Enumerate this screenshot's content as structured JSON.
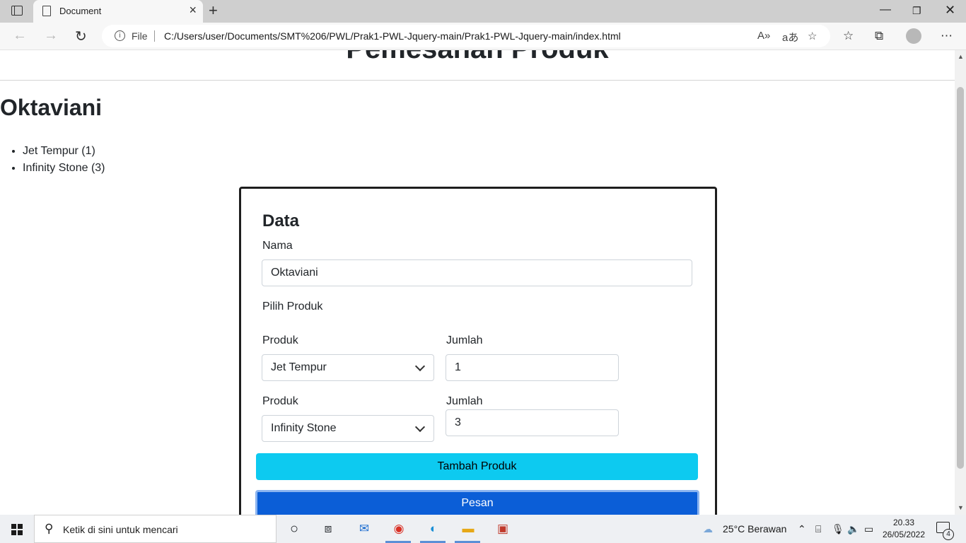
{
  "browser": {
    "tab_title": "Document",
    "file_label": "File",
    "url": "C:/Users/user/Documents/SMT%206/PWL/Prak1-PWL-Jquery-main/Prak1-PWL-Jquery-main/index.html"
  },
  "page": {
    "title": "Pemesanan Produk",
    "customer_name": "Oktaviani",
    "order_items": [
      "Jet Tempur (1)",
      "Infinity Stone (3)"
    ]
  },
  "form": {
    "heading": "Data",
    "name_label": "Nama",
    "name_value": "Oktaviani",
    "choose_label": "Pilih Produk",
    "rows": [
      {
        "product_label": "Produk",
        "product_value": "Jet Tempur",
        "qty_label": "Jumlah",
        "qty_value": "1"
      },
      {
        "product_label": "Produk",
        "product_value": "Infinity Stone",
        "qty_label": "Jumlah",
        "qty_value": "3"
      }
    ],
    "add_button": "Tambah Produk",
    "submit_button": "Pesan"
  },
  "taskbar": {
    "search_placeholder": "Ketik di sini untuk mencari",
    "weather": "25°C  Berawan",
    "time": "20.33",
    "date": "26/05/2022",
    "notification_count": "4"
  },
  "colors": {
    "add_button": "#0dcaf0",
    "submit_button": "#0b5ed7"
  }
}
